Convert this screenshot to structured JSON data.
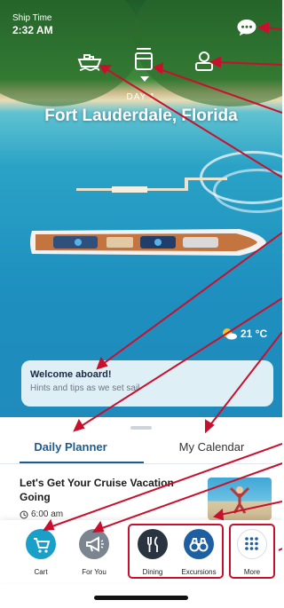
{
  "status": {
    "ship_time_label": "Ship Time",
    "ship_time": "2:32 AM"
  },
  "header": {
    "day_label": "DAY 1",
    "port_title": "Fort Lauderdale, Florida"
  },
  "weather": {
    "temperature": "21 °C",
    "icon": "sun-cloud-icon"
  },
  "welcome_card": {
    "title": "Welcome aboard!",
    "subtitle": "Hints and tips as we set sail"
  },
  "tabs": [
    {
      "label": "Daily Planner",
      "selected": true
    },
    {
      "label": "My Calendar",
      "selected": false
    }
  ],
  "event": {
    "title": "Let's Get Your Cruise Vacation Going",
    "time": "6:00 am"
  },
  "actions": [
    {
      "label": "Cart",
      "icon": "cart-icon",
      "color": "#1aa0c8"
    },
    {
      "label": "For You",
      "icon": "megaphone-icon",
      "color": "#7a8590"
    },
    {
      "label": "Dining",
      "icon": "fork-knife-icon",
      "color": "#2a3440"
    },
    {
      "label": "Excursions",
      "icon": "binoculars-icon",
      "color": "#1d5fa0"
    },
    {
      "label": "More",
      "icon": "grid-icon",
      "color": "#ffffff"
    }
  ],
  "colors": {
    "accent": "#1f5b8a",
    "annotation_red": "#c8102e"
  }
}
